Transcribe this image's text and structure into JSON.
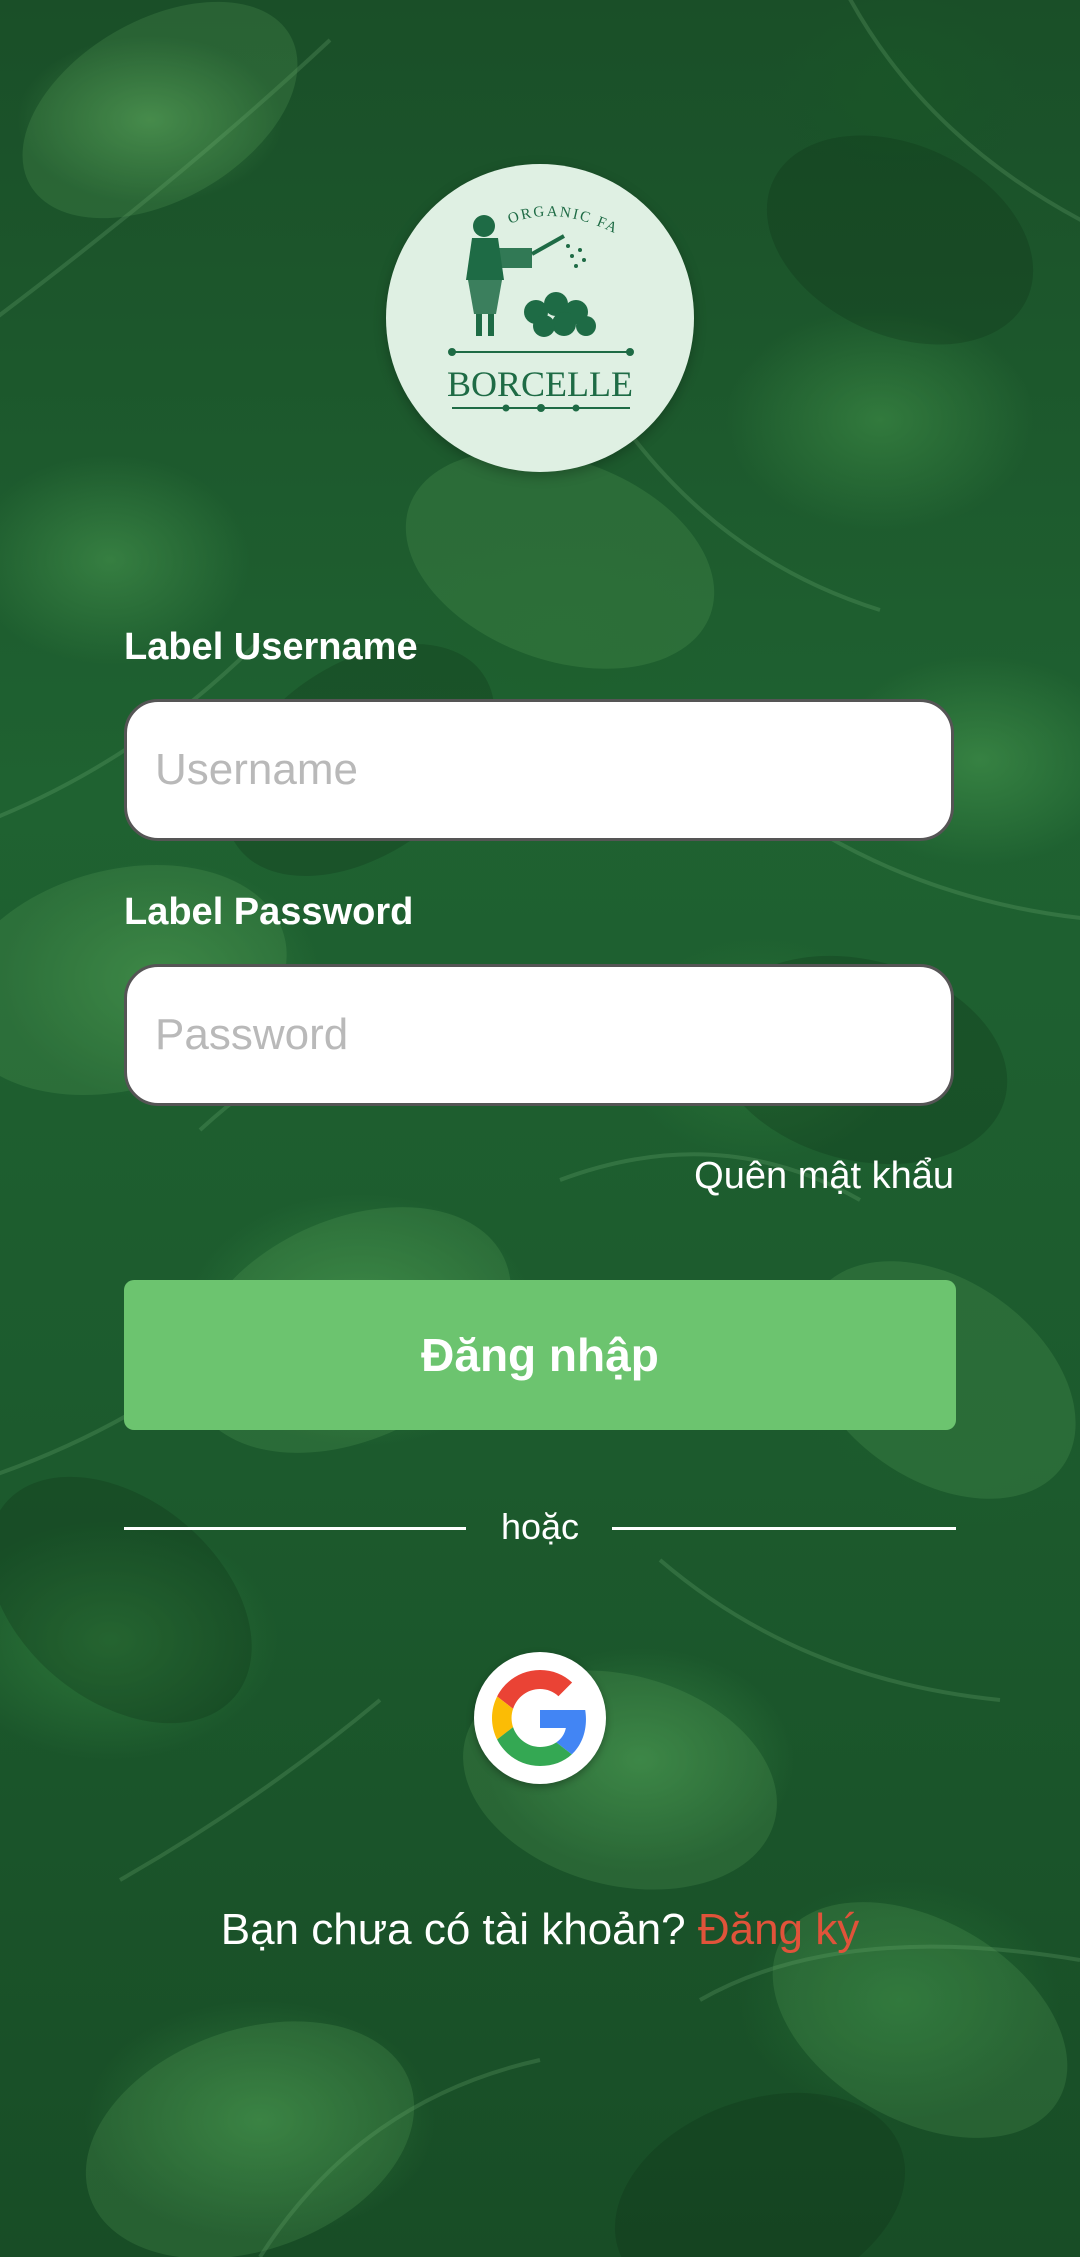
{
  "logo": {
    "top_text": "ORGANIC FARM",
    "brand": "BORCELLE"
  },
  "form": {
    "username_label": "Label Username",
    "username_placeholder": "Username",
    "password_label": "Label Password",
    "password_placeholder": "Password",
    "forgot_password": "Quên mật khẩu",
    "login_button": "Đăng nhập",
    "divider_text": "hoặc"
  },
  "signup": {
    "prompt": "Bạn chưa có tài khoản?",
    "link": "Đăng ký"
  },
  "icons": {
    "social": "google-icon"
  },
  "colors": {
    "background": "#1f6231",
    "login_button": "#6cc46f",
    "signup_link": "#e0533a",
    "logo_circle": "#dff0e3",
    "logo_ink": "#1e6b45"
  }
}
